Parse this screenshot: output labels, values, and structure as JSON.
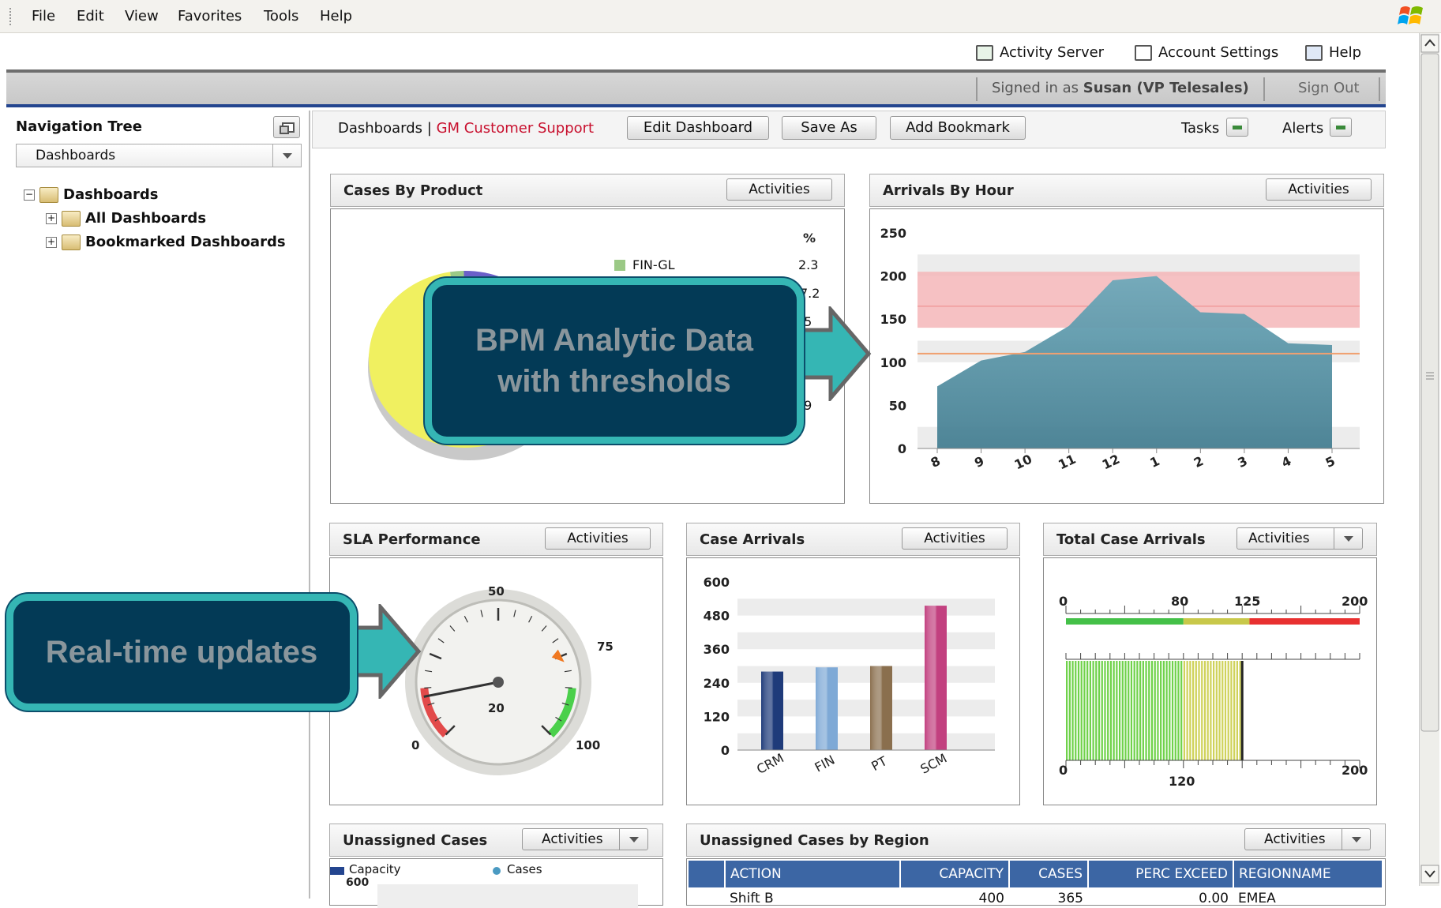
{
  "menu": {
    "items": [
      "File",
      "Edit",
      "View",
      "Favorites",
      "Tools",
      "Help"
    ]
  },
  "toplinks": {
    "activity_server": "Activity Server",
    "account_settings": "Account Settings",
    "help": "Help"
  },
  "session": {
    "signed_in_prefix": "Signed in as",
    "user": "Susan (VP Telesales)",
    "sign_out": "Sign Out"
  },
  "nav": {
    "title": "Navigation Tree",
    "select_value": "Dashboards",
    "tree": {
      "root": "Dashboards",
      "children": [
        "All Dashboards",
        "Bookmarked Dashboards"
      ]
    }
  },
  "header": {
    "crumb_root": "Dashboards",
    "crumb_sep": "|",
    "crumb_current": "GM Customer Support",
    "edit_dashboard": "Edit Dashboard",
    "save_as": "Save As",
    "add_bookmark": "Add Bookmark",
    "tasks": "Tasks",
    "alerts": "Alerts"
  },
  "panels": {
    "activities": "Activities",
    "cases_by_product": {
      "title": "Cases By Product",
      "pct_header": "%",
      "legend_visible": "FIN-GL",
      "values_visible": [
        "2.3",
        "7.2",
        ".5",
        ".9"
      ]
    },
    "arrivals_by_hour": {
      "title": "Arrivals By Hour"
    },
    "sla_performance": {
      "title": "SLA Performance",
      "labels": [
        "50",
        "75",
        "20",
        "0",
        "100"
      ]
    },
    "case_arrivals": {
      "title": "Case Arrivals"
    },
    "total_case_arrivals": {
      "title": "Total Case Arrivals",
      "top_ticks": [
        "0",
        "80",
        "125",
        "200"
      ],
      "bottom_ticks": [
        "0",
        "200"
      ],
      "bottom_value": "120"
    },
    "unassigned_cases": {
      "title": "Unassigned Cases",
      "legend": [
        "Capacity",
        "Cases"
      ],
      "y_top": "600"
    },
    "unassigned_by_region": {
      "title": "Unassigned Cases by Region",
      "columns": [
        "ACTION",
        "CAPACITY",
        "CASES",
        "PERC EXCEED",
        "REGIONNAME"
      ],
      "row_partial": [
        "Shift B",
        "400",
        "365",
        "0.00",
        "EMEA"
      ]
    }
  },
  "callouts": {
    "analytic_line1": "BPM Analytic Data",
    "analytic_line2": "with thresholds",
    "realtime": "Real-time updates"
  },
  "chart_data": [
    {
      "type": "pie",
      "title": "Cases By Product",
      "slices": [
        {
          "label": "FIN-GL",
          "value": 2.3,
          "color": "#9bc986"
        },
        {
          "label": "",
          "value": 7.2,
          "color": "#6b5fc9"
        },
        {
          "label": "",
          "value": 30.5,
          "color": "#37b4f2"
        },
        {
          "label": "",
          "value": 59.9,
          "color": "#f0f060"
        }
      ],
      "note": "partially obscured by callout"
    },
    {
      "type": "area",
      "title": "Arrivals By Hour",
      "categories": [
        "8",
        "9",
        "10",
        "11",
        "12",
        "1",
        "2",
        "3",
        "4",
        "5"
      ],
      "values": [
        72,
        102,
        112,
        142,
        195,
        200,
        158,
        156,
        122,
        120
      ],
      "ylim": [
        0,
        250
      ],
      "yticks": [
        0,
        50,
        100,
        150,
        200,
        250
      ],
      "threshold_band": [
        140,
        205
      ],
      "threshold_line": 110,
      "colors": {
        "area": "#5f95a6",
        "band": "#f4b6b8",
        "line": "#f0a070"
      }
    },
    {
      "type": "bar",
      "title": "Case Arrivals",
      "categories": [
        "CRM",
        "FIN",
        "PT",
        "SCM"
      ],
      "values": [
        280,
        295,
        300,
        515
      ],
      "ylim": [
        0,
        600
      ],
      "yticks": [
        0,
        120,
        240,
        360,
        480,
        600
      ],
      "colors": [
        "#1f3b7a",
        "#7ea9d6",
        "#8a6f4e",
        "#c2407f"
      ]
    },
    {
      "type": "gauge",
      "title": "SLA Performance",
      "range": [
        0,
        100
      ],
      "needle": 20,
      "marker": 75
    },
    {
      "type": "bullet",
      "title": "Total Case Arrivals",
      "range": [
        0,
        200
      ],
      "bands": [
        {
          "to": 80,
          "color": "#44c048"
        },
        {
          "to": 125,
          "color": "#c8c84a"
        },
        {
          "to": 200,
          "color": "#e83030"
        }
      ],
      "value": 120
    }
  ]
}
